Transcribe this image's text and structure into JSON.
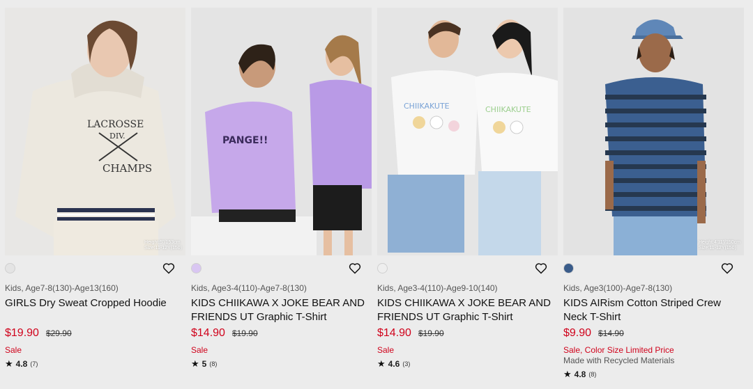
{
  "colors": {
    "sale": "#d0021b",
    "page_bg": "#ececec"
  },
  "products": [
    {
      "swatch_color": "#e4e4e4",
      "size_note_1": "Height:5\"/153cm",
      "size_note_2": "Size:11-12Y(150)",
      "meta": "Kids, Age7-8(130)-Age13(160)",
      "title": "GIRLS Dry Sweat Cropped Hoodie",
      "price_now": "$19.90",
      "price_old": "$29.90",
      "flags": "Sale",
      "note": "",
      "rating_score": "4.8",
      "rating_count": "(7)",
      "favorite_icon": "heart-outline-icon"
    },
    {
      "swatch_color": "#d9c6f2",
      "size_note_1": "",
      "size_note_2": "",
      "meta": "Kids, Age3-4(110)-Age7-8(130)",
      "title": "KIDS CHIIKAWA X JOKE BEAR AND FRIENDS UT Graphic T-Shirt",
      "price_now": "$14.90",
      "price_old": "$19.90",
      "flags": "Sale",
      "note": "",
      "rating_score": "5",
      "rating_count": "(8)",
      "favorite_icon": "heart-outline-icon"
    },
    {
      "swatch_color": "#eeeeee",
      "size_note_1": "",
      "size_note_2": "",
      "meta": "Kids, Age3-4(110)-Age9-10(140)",
      "title": "KIDS CHIIKAWA X JOKE BEAR AND FRIENDS UT Graphic T-Shirt",
      "price_now": "$14.90",
      "price_old": "$19.90",
      "flags": "Sale",
      "note": "",
      "rating_score": "4.6",
      "rating_count": "(3)",
      "favorite_icon": "heart-outline-icon"
    },
    {
      "swatch_color": "#3a5c8a",
      "size_note_1": "Height:4'11\"/150cm",
      "size_note_2": "Size:11-12Y(150)",
      "meta": "Kids, Age3(100)-Age7-8(130)",
      "title": "KIDS AIRism Cotton Striped Crew Neck T-Shirt",
      "price_now": "$9.90",
      "price_old": "$14.90",
      "flags": "Sale, Color Size Limited Price",
      "note": "Made with Recycled Materials",
      "rating_score": "4.8",
      "rating_count": "(8)",
      "favorite_icon": "heart-outline-icon"
    }
  ]
}
